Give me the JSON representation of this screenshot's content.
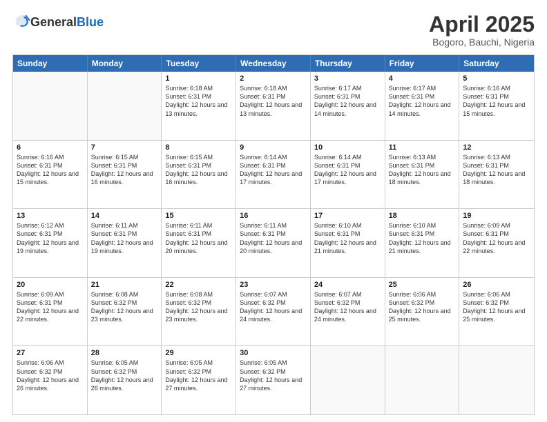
{
  "header": {
    "logo_general": "General",
    "logo_blue": "Blue",
    "month_title": "April 2025",
    "subtitle": "Bogoro, Bauchi, Nigeria"
  },
  "days_of_week": [
    "Sunday",
    "Monday",
    "Tuesday",
    "Wednesday",
    "Thursday",
    "Friday",
    "Saturday"
  ],
  "weeks": [
    [
      {
        "day": "",
        "info": ""
      },
      {
        "day": "",
        "info": ""
      },
      {
        "day": "1",
        "info": "Sunrise: 6:18 AM\nSunset: 6:31 PM\nDaylight: 12 hours and 13 minutes."
      },
      {
        "day": "2",
        "info": "Sunrise: 6:18 AM\nSunset: 6:31 PM\nDaylight: 12 hours and 13 minutes."
      },
      {
        "day": "3",
        "info": "Sunrise: 6:17 AM\nSunset: 6:31 PM\nDaylight: 12 hours and 14 minutes."
      },
      {
        "day": "4",
        "info": "Sunrise: 6:17 AM\nSunset: 6:31 PM\nDaylight: 12 hours and 14 minutes."
      },
      {
        "day": "5",
        "info": "Sunrise: 6:16 AM\nSunset: 6:31 PM\nDaylight: 12 hours and 15 minutes."
      }
    ],
    [
      {
        "day": "6",
        "info": "Sunrise: 6:16 AM\nSunset: 6:31 PM\nDaylight: 12 hours and 15 minutes."
      },
      {
        "day": "7",
        "info": "Sunrise: 6:15 AM\nSunset: 6:31 PM\nDaylight: 12 hours and 16 minutes."
      },
      {
        "day": "8",
        "info": "Sunrise: 6:15 AM\nSunset: 6:31 PM\nDaylight: 12 hours and 16 minutes."
      },
      {
        "day": "9",
        "info": "Sunrise: 6:14 AM\nSunset: 6:31 PM\nDaylight: 12 hours and 17 minutes."
      },
      {
        "day": "10",
        "info": "Sunrise: 6:14 AM\nSunset: 6:31 PM\nDaylight: 12 hours and 17 minutes."
      },
      {
        "day": "11",
        "info": "Sunrise: 6:13 AM\nSunset: 6:31 PM\nDaylight: 12 hours and 18 minutes."
      },
      {
        "day": "12",
        "info": "Sunrise: 6:13 AM\nSunset: 6:31 PM\nDaylight: 12 hours and 18 minutes."
      }
    ],
    [
      {
        "day": "13",
        "info": "Sunrise: 6:12 AM\nSunset: 6:31 PM\nDaylight: 12 hours and 19 minutes."
      },
      {
        "day": "14",
        "info": "Sunrise: 6:11 AM\nSunset: 6:31 PM\nDaylight: 12 hours and 19 minutes."
      },
      {
        "day": "15",
        "info": "Sunrise: 6:11 AM\nSunset: 6:31 PM\nDaylight: 12 hours and 20 minutes."
      },
      {
        "day": "16",
        "info": "Sunrise: 6:11 AM\nSunset: 6:31 PM\nDaylight: 12 hours and 20 minutes."
      },
      {
        "day": "17",
        "info": "Sunrise: 6:10 AM\nSunset: 6:31 PM\nDaylight: 12 hours and 21 minutes."
      },
      {
        "day": "18",
        "info": "Sunrise: 6:10 AM\nSunset: 6:31 PM\nDaylight: 12 hours and 21 minutes."
      },
      {
        "day": "19",
        "info": "Sunrise: 6:09 AM\nSunset: 6:31 PM\nDaylight: 12 hours and 22 minutes."
      }
    ],
    [
      {
        "day": "20",
        "info": "Sunrise: 6:09 AM\nSunset: 6:31 PM\nDaylight: 12 hours and 22 minutes."
      },
      {
        "day": "21",
        "info": "Sunrise: 6:08 AM\nSunset: 6:32 PM\nDaylight: 12 hours and 23 minutes."
      },
      {
        "day": "22",
        "info": "Sunrise: 6:08 AM\nSunset: 6:32 PM\nDaylight: 12 hours and 23 minutes."
      },
      {
        "day": "23",
        "info": "Sunrise: 6:07 AM\nSunset: 6:32 PM\nDaylight: 12 hours and 24 minutes."
      },
      {
        "day": "24",
        "info": "Sunrise: 6:07 AM\nSunset: 6:32 PM\nDaylight: 12 hours and 24 minutes."
      },
      {
        "day": "25",
        "info": "Sunrise: 6:06 AM\nSunset: 6:32 PM\nDaylight: 12 hours and 25 minutes."
      },
      {
        "day": "26",
        "info": "Sunrise: 6:06 AM\nSunset: 6:32 PM\nDaylight: 12 hours and 25 minutes."
      }
    ],
    [
      {
        "day": "27",
        "info": "Sunrise: 6:06 AM\nSunset: 6:32 PM\nDaylight: 12 hours and 26 minutes."
      },
      {
        "day": "28",
        "info": "Sunrise: 6:05 AM\nSunset: 6:32 PM\nDaylight: 12 hours and 26 minutes."
      },
      {
        "day": "29",
        "info": "Sunrise: 6:05 AM\nSunset: 6:32 PM\nDaylight: 12 hours and 27 minutes."
      },
      {
        "day": "30",
        "info": "Sunrise: 6:05 AM\nSunset: 6:32 PM\nDaylight: 12 hours and 27 minutes."
      },
      {
        "day": "",
        "info": ""
      },
      {
        "day": "",
        "info": ""
      },
      {
        "day": "",
        "info": ""
      }
    ]
  ]
}
